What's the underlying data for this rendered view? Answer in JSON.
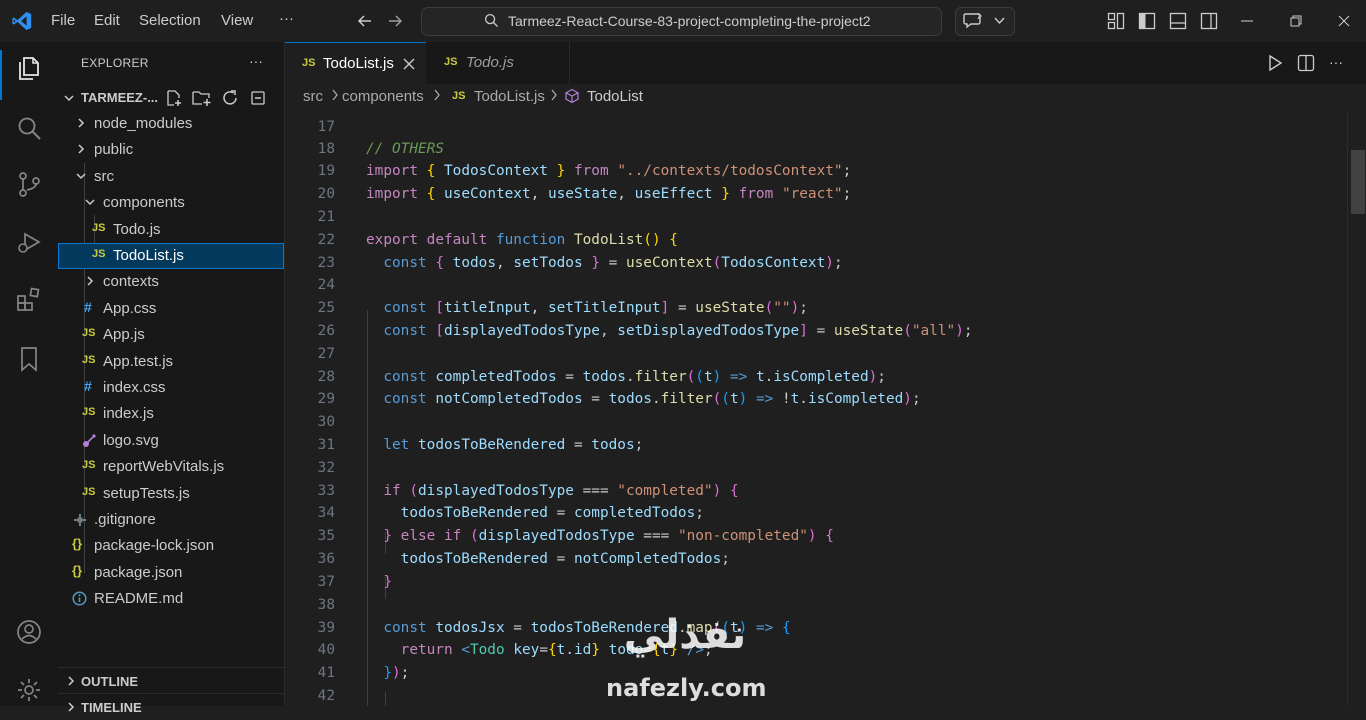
{
  "menu": {
    "file": "File",
    "edit": "Edit",
    "selection": "Selection",
    "view": "View",
    "more": "···"
  },
  "search": {
    "text": "Tarmeez-React-Course-83-project-completing-the-project2"
  },
  "sidebar": {
    "title": "EXPLORER",
    "more": "···",
    "root": "TARMEEZ-...",
    "items": [
      {
        "label": "node_modules",
        "kind": "folder",
        "icon": ""
      },
      {
        "label": "public",
        "kind": "folder",
        "icon": ""
      },
      {
        "label": "src",
        "kind": "folder-open",
        "icon": ""
      },
      {
        "label": "components",
        "kind": "folder-open",
        "icon": ""
      },
      {
        "label": "Todo.js",
        "kind": "file",
        "icon": "JS"
      },
      {
        "label": "TodoList.js",
        "kind": "file",
        "icon": "JS"
      },
      {
        "label": "contexts",
        "kind": "folder",
        "icon": ""
      },
      {
        "label": "App.css",
        "kind": "file",
        "icon": "#"
      },
      {
        "label": "App.js",
        "kind": "file",
        "icon": "JS"
      },
      {
        "label": "App.test.js",
        "kind": "file",
        "icon": "JS"
      },
      {
        "label": "index.css",
        "kind": "file",
        "icon": "#"
      },
      {
        "label": "index.js",
        "kind": "file",
        "icon": "JS"
      },
      {
        "label": "logo.svg",
        "kind": "file",
        "icon": "svg-icon"
      },
      {
        "label": "reportWebVitals.js",
        "kind": "file",
        "icon": "JS"
      },
      {
        "label": "setupTests.js",
        "kind": "file",
        "icon": "JS"
      },
      {
        "label": ".gitignore",
        "kind": "file",
        "icon": "gear-icon"
      },
      {
        "label": "package-lock.json",
        "kind": "file",
        "icon": "{}"
      },
      {
        "label": "package.json",
        "kind": "file",
        "icon": "{}"
      },
      {
        "label": "README.md",
        "kind": "file",
        "icon": "info-icon"
      }
    ],
    "outline": "OUTLINE",
    "timeline": "TIMELINE"
  },
  "tabs": [
    {
      "icon": "JS",
      "label": "TodoList.js",
      "active": true
    },
    {
      "icon": "JS",
      "label": "Todo.js",
      "active": false
    }
  ],
  "breadcrumb": {
    "src": "src",
    "components": "components",
    "icon": "JS",
    "file": "TodoList.js",
    "symbol": "TodoList"
  },
  "code": {
    "ln": [
      "17",
      "18",
      "19",
      "20",
      "21",
      "22",
      "23",
      "24",
      "25",
      "26",
      "27",
      "28",
      "29",
      "30",
      "31",
      "32",
      "33",
      "34",
      "35",
      "36",
      "37",
      "38",
      "39",
      "40",
      "41",
      "42"
    ],
    "l18_comment": "// OTHERS",
    "import": "import",
    "from": "from",
    "l19_name": "TodosContext",
    "l19_path": "\"../contexts/todosContext\"",
    "l20_a": "useContext",
    "l20_b": "useState",
    "l20_c": "useEffect",
    "l20_path": "\"react\"",
    "export": "export",
    "default": "default",
    "function": "function",
    "fname": "TodoList",
    "const": "const",
    "let": "let",
    "if": "if",
    "else": "else",
    "return": "return",
    "todos": "todos",
    "setTodos": "setTodos",
    "useContext": "useContext",
    "useState": "useState",
    "TodosContext": "TodosContext",
    "titleInput": "titleInput",
    "setTitleInput": "setTitleInput",
    "emptyStr": "\"\"",
    "displayedTodosType": "displayedTodosType",
    "setDisplayedTodosType": "setDisplayedTodosType",
    "allStr": "\"all\"",
    "completedTodos": "completedTodos",
    "notCompletedTodos": "notCompletedTodos",
    "filter": "filter",
    "t": "t",
    "isCompleted": "isCompleted",
    "todosToBeRendered": "todosToBeRendered",
    "completedStr": "\"completed\"",
    "nonCompletedStr": "\"non-completed\"",
    "todosJsx": "todosJsx",
    "map": "map",
    "Todo": "Todo",
    "key": "key",
    "id": "id",
    "todo": "todo"
  },
  "watermark": {
    "ar": "نفذلي",
    "en": "nafezly.com"
  },
  "colors": {
    "accent": "#0078d4",
    "js_icon": "#cbcb41",
    "css_icon": "#42a5f5",
    "json_icon": "#cbcb41"
  }
}
